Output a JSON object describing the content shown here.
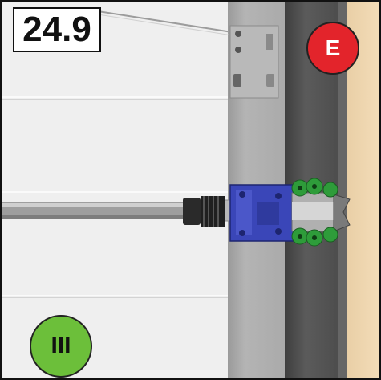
{
  "step_number": "24.9",
  "badges": {
    "e": {
      "label": "E",
      "color": "#e3242b"
    },
    "iii": {
      "label": "III",
      "color": "#6cbf3a"
    }
  },
  "colors": {
    "bracket": "#3a46b8",
    "rollers": "#2e9c3a",
    "wood": "#f0d6ae",
    "post_dark": "#4a4a4a",
    "post_light": "#aaaaaa"
  }
}
